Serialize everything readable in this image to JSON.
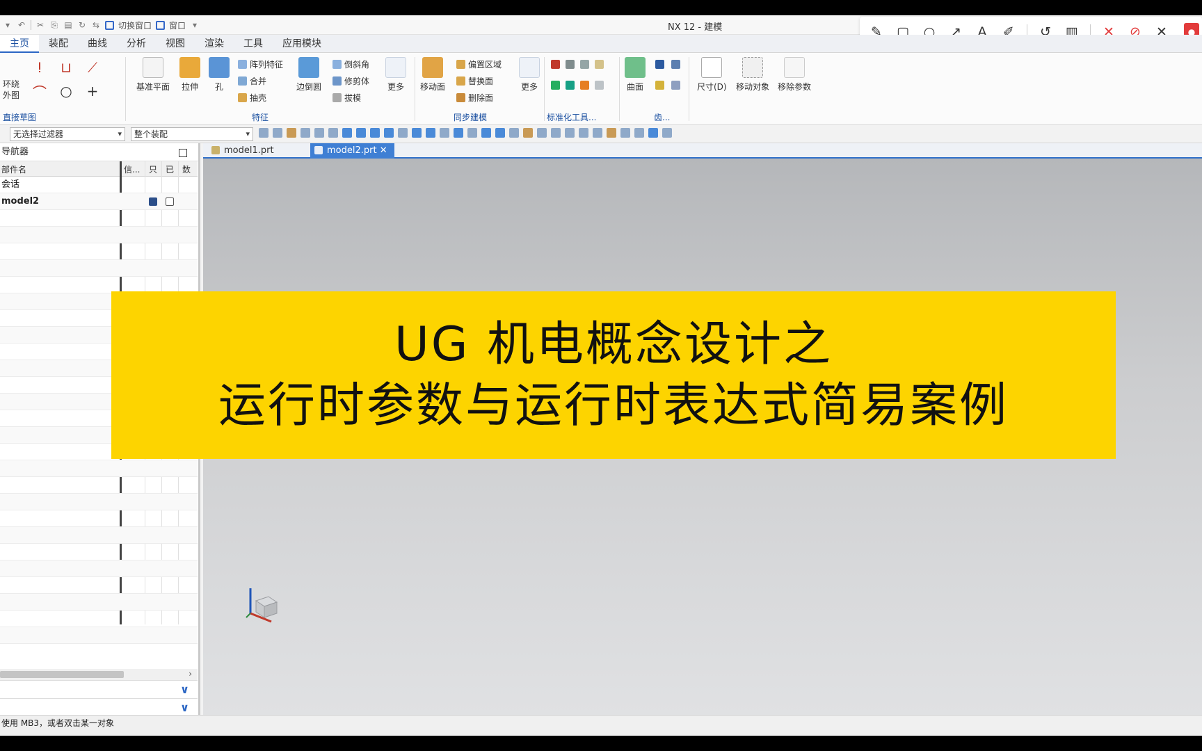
{
  "app": {
    "window_title": "NX 12 - 建模",
    "quick_access": {
      "items": [
        "切换窗口",
        "窗口"
      ]
    }
  },
  "overlay": {
    "tools": [
      "pencil-icon",
      "rectangle-icon",
      "circle-icon",
      "arrow-icon",
      "text-icon",
      "highlighter-icon",
      "undo-icon",
      "trash-icon",
      "speaker-muted-icon",
      "mic-muted-icon",
      "close-icon"
    ]
  },
  "menu": {
    "tabs": [
      "主页",
      "装配",
      "曲线",
      "分析",
      "视图",
      "渲染",
      "工具",
      "应用模块"
    ],
    "active": 0
  },
  "ribbon": {
    "sketch_labels": {
      "loop": "环绕",
      "view": "外图",
      "group": "直接草图"
    },
    "feature": {
      "datum_plane": "基准平面",
      "extrude": "拉伸",
      "hole": "孔",
      "more_features": "阵列特征",
      "unite": "合并",
      "shell": "抽壳",
      "trim_body": "修剪体",
      "edge_blend": "边倒圆",
      "chamfer": "倒斜角",
      "more": "更多",
      "draft": "拔模",
      "group": "特征"
    },
    "sync": {
      "move_face": "移动面",
      "offset_region": "偏置区域",
      "replace_face": "替换面",
      "delete_face": "删除面",
      "more": "更多",
      "group": "同步建模"
    },
    "standard": {
      "group": "标准化工具..."
    },
    "surface": {
      "label": "曲面",
      "group": "齿..."
    },
    "dims": {
      "size": "尺寸(D)",
      "move": "移动对象",
      "remove_params": "移除参数"
    }
  },
  "selection_bar": {
    "filter": "无选择过滤器",
    "scope": "整个装配"
  },
  "navigator": {
    "title": "导航器",
    "columns": {
      "name": "部件名",
      "info": "信...",
      "readonly": "只",
      "modified": "已",
      "count": "数"
    },
    "rows": [
      {
        "name": "会话"
      },
      {
        "name": "model2"
      }
    ]
  },
  "documents": {
    "tabs": [
      {
        "label": "model1.prt"
      },
      {
        "label": "model2.prt"
      }
    ]
  },
  "banner": {
    "line1": "UG 机电概念设计之",
    "line2": "运行时参数与运行时表达式简易案例"
  },
  "colors": {
    "banner_bg": "#fdd400",
    "accent": "#2e6fc9",
    "record": "#e23b3b"
  },
  "status": {
    "text": "使用 MB3，或者双击某一对象"
  }
}
